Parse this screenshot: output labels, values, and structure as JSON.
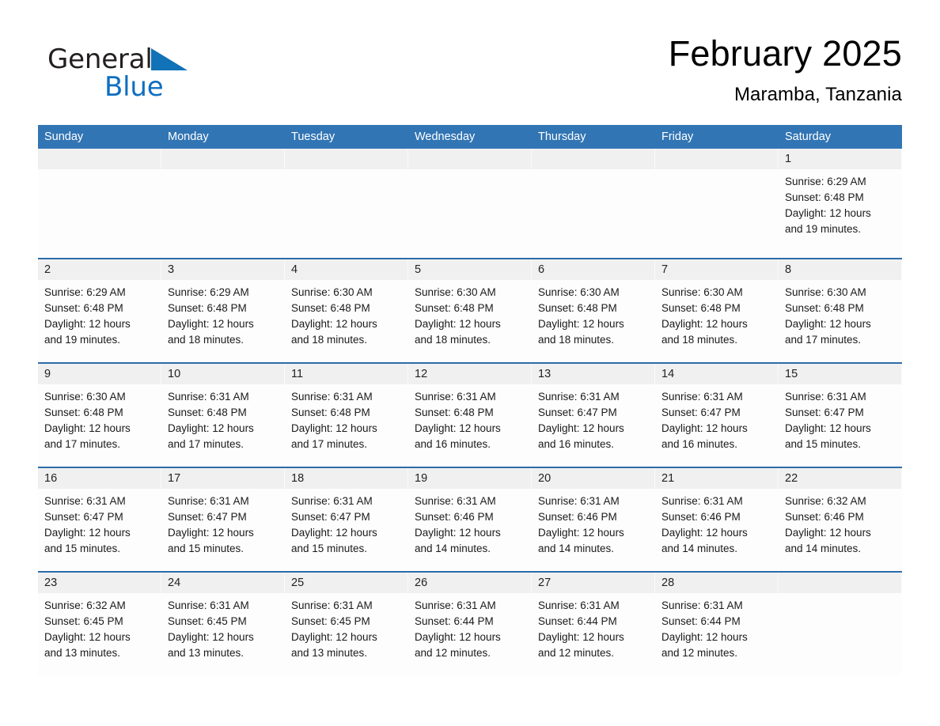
{
  "brand": {
    "name_part1": "General",
    "name_part2": "Blue",
    "triangle_color": "#1272b8",
    "text_color": "#231f20"
  },
  "header": {
    "month_title": "February 2025",
    "location": "Maramba, Tanzania"
  },
  "theme": {
    "header_blue": "#3275b4",
    "row_border_blue": "#2d6ca8",
    "date_band_gray": "#f0f0f0",
    "cell_white": "#fdfdfe"
  },
  "weekdays": [
    "Sunday",
    "Monday",
    "Tuesday",
    "Wednesday",
    "Thursday",
    "Friday",
    "Saturday"
  ],
  "weeks": [
    [
      {
        "day": "",
        "lines": []
      },
      {
        "day": "",
        "lines": []
      },
      {
        "day": "",
        "lines": []
      },
      {
        "day": "",
        "lines": []
      },
      {
        "day": "",
        "lines": []
      },
      {
        "day": "",
        "lines": []
      },
      {
        "day": "1",
        "lines": [
          "Sunrise: 6:29 AM",
          "Sunset: 6:48 PM",
          "Daylight: 12 hours",
          "and 19 minutes."
        ]
      }
    ],
    [
      {
        "day": "2",
        "lines": [
          "Sunrise: 6:29 AM",
          "Sunset: 6:48 PM",
          "Daylight: 12 hours",
          "and 19 minutes."
        ]
      },
      {
        "day": "3",
        "lines": [
          "Sunrise: 6:29 AM",
          "Sunset: 6:48 PM",
          "Daylight: 12 hours",
          "and 18 minutes."
        ]
      },
      {
        "day": "4",
        "lines": [
          "Sunrise: 6:30 AM",
          "Sunset: 6:48 PM",
          "Daylight: 12 hours",
          "and 18 minutes."
        ]
      },
      {
        "day": "5",
        "lines": [
          "Sunrise: 6:30 AM",
          "Sunset: 6:48 PM",
          "Daylight: 12 hours",
          "and 18 minutes."
        ]
      },
      {
        "day": "6",
        "lines": [
          "Sunrise: 6:30 AM",
          "Sunset: 6:48 PM",
          "Daylight: 12 hours",
          "and 18 minutes."
        ]
      },
      {
        "day": "7",
        "lines": [
          "Sunrise: 6:30 AM",
          "Sunset: 6:48 PM",
          "Daylight: 12 hours",
          "and 18 minutes."
        ]
      },
      {
        "day": "8",
        "lines": [
          "Sunrise: 6:30 AM",
          "Sunset: 6:48 PM",
          "Daylight: 12 hours",
          "and 17 minutes."
        ]
      }
    ],
    [
      {
        "day": "9",
        "lines": [
          "Sunrise: 6:30 AM",
          "Sunset: 6:48 PM",
          "Daylight: 12 hours",
          "and 17 minutes."
        ]
      },
      {
        "day": "10",
        "lines": [
          "Sunrise: 6:31 AM",
          "Sunset: 6:48 PM",
          "Daylight: 12 hours",
          "and 17 minutes."
        ]
      },
      {
        "day": "11",
        "lines": [
          "Sunrise: 6:31 AM",
          "Sunset: 6:48 PM",
          "Daylight: 12 hours",
          "and 17 minutes."
        ]
      },
      {
        "day": "12",
        "lines": [
          "Sunrise: 6:31 AM",
          "Sunset: 6:48 PM",
          "Daylight: 12 hours",
          "and 16 minutes."
        ]
      },
      {
        "day": "13",
        "lines": [
          "Sunrise: 6:31 AM",
          "Sunset: 6:47 PM",
          "Daylight: 12 hours",
          "and 16 minutes."
        ]
      },
      {
        "day": "14",
        "lines": [
          "Sunrise: 6:31 AM",
          "Sunset: 6:47 PM",
          "Daylight: 12 hours",
          "and 16 minutes."
        ]
      },
      {
        "day": "15",
        "lines": [
          "Sunrise: 6:31 AM",
          "Sunset: 6:47 PM",
          "Daylight: 12 hours",
          "and 15 minutes."
        ]
      }
    ],
    [
      {
        "day": "16",
        "lines": [
          "Sunrise: 6:31 AM",
          "Sunset: 6:47 PM",
          "Daylight: 12 hours",
          "and 15 minutes."
        ]
      },
      {
        "day": "17",
        "lines": [
          "Sunrise: 6:31 AM",
          "Sunset: 6:47 PM",
          "Daylight: 12 hours",
          "and 15 minutes."
        ]
      },
      {
        "day": "18",
        "lines": [
          "Sunrise: 6:31 AM",
          "Sunset: 6:47 PM",
          "Daylight: 12 hours",
          "and 15 minutes."
        ]
      },
      {
        "day": "19",
        "lines": [
          "Sunrise: 6:31 AM",
          "Sunset: 6:46 PM",
          "Daylight: 12 hours",
          "and 14 minutes."
        ]
      },
      {
        "day": "20",
        "lines": [
          "Sunrise: 6:31 AM",
          "Sunset: 6:46 PM",
          "Daylight: 12 hours",
          "and 14 minutes."
        ]
      },
      {
        "day": "21",
        "lines": [
          "Sunrise: 6:31 AM",
          "Sunset: 6:46 PM",
          "Daylight: 12 hours",
          "and 14 minutes."
        ]
      },
      {
        "day": "22",
        "lines": [
          "Sunrise: 6:32 AM",
          "Sunset: 6:46 PM",
          "Daylight: 12 hours",
          "and 14 minutes."
        ]
      }
    ],
    [
      {
        "day": "23",
        "lines": [
          "Sunrise: 6:32 AM",
          "Sunset: 6:45 PM",
          "Daylight: 12 hours",
          "and 13 minutes."
        ]
      },
      {
        "day": "24",
        "lines": [
          "Sunrise: 6:31 AM",
          "Sunset: 6:45 PM",
          "Daylight: 12 hours",
          "and 13 minutes."
        ]
      },
      {
        "day": "25",
        "lines": [
          "Sunrise: 6:31 AM",
          "Sunset: 6:45 PM",
          "Daylight: 12 hours",
          "and 13 minutes."
        ]
      },
      {
        "day": "26",
        "lines": [
          "Sunrise: 6:31 AM",
          "Sunset: 6:44 PM",
          "Daylight: 12 hours",
          "and 12 minutes."
        ]
      },
      {
        "day": "27",
        "lines": [
          "Sunrise: 6:31 AM",
          "Sunset: 6:44 PM",
          "Daylight: 12 hours",
          "and 12 minutes."
        ]
      },
      {
        "day": "28",
        "lines": [
          "Sunrise: 6:31 AM",
          "Sunset: 6:44 PM",
          "Daylight: 12 hours",
          "and 12 minutes."
        ]
      },
      {
        "day": "",
        "lines": []
      }
    ]
  ]
}
